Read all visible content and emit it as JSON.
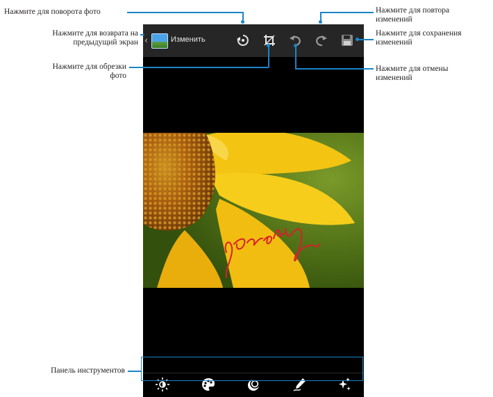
{
  "app": {
    "title": "Изменить",
    "back_icon": "chevron-left-icon",
    "app_icon": "gallery-icon"
  },
  "callouts": {
    "rotate": "Нажмите для поворота фото",
    "back": "Нажмите для возврата на\nпредыдущий экран",
    "crop": "Нажмите для обрезки\nфото",
    "redo": "Нажмите для повтора\nизменений",
    "save": "Нажмите для сохранения\nизменений",
    "undo": "Нажмите для отмены\nизменений",
    "toolbar": "Панель инструментов"
  },
  "actionbar_icons": [
    "rotate-icon",
    "crop-icon",
    "undo-icon",
    "redo-icon",
    "save-icon"
  ],
  "toolbar_icons": [
    "brightness-icon",
    "palette-icon",
    "frame-icon",
    "pen-icon",
    "sparkle-icon"
  ],
  "photo": {
    "handwriting": "pretty"
  },
  "colors": {
    "accent": "#1a85c8",
    "actionbar": "#262626",
    "handwriting": "#d9202a"
  }
}
